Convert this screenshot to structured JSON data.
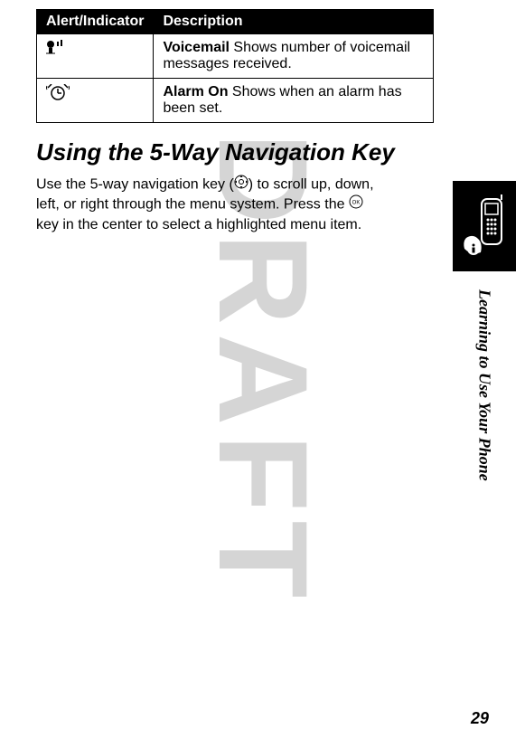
{
  "table": {
    "headers": {
      "col1": "Alert/Indicator",
      "col2": "Description"
    },
    "rows": [
      {
        "icon": "voicemail-indicator-icon",
        "bold": "Voicemail",
        "text": "  Shows number of voicemail messages received."
      },
      {
        "icon": "alarm-on-indicator-icon",
        "bold": "Alarm On",
        "text": "  Shows when an alarm has been set."
      }
    ]
  },
  "section": {
    "title": "Using the 5-Way Navigation Key",
    "body_part1": "Use the 5-way navigation key (",
    "body_part2": ") to scroll up, down, left, or right through the menu system. Press the ",
    "body_part3": " key in the center to select a highlighted menu item."
  },
  "side_label": "Learning to Use Your Phone",
  "page_number": "29",
  "watermark": "DRAFT"
}
